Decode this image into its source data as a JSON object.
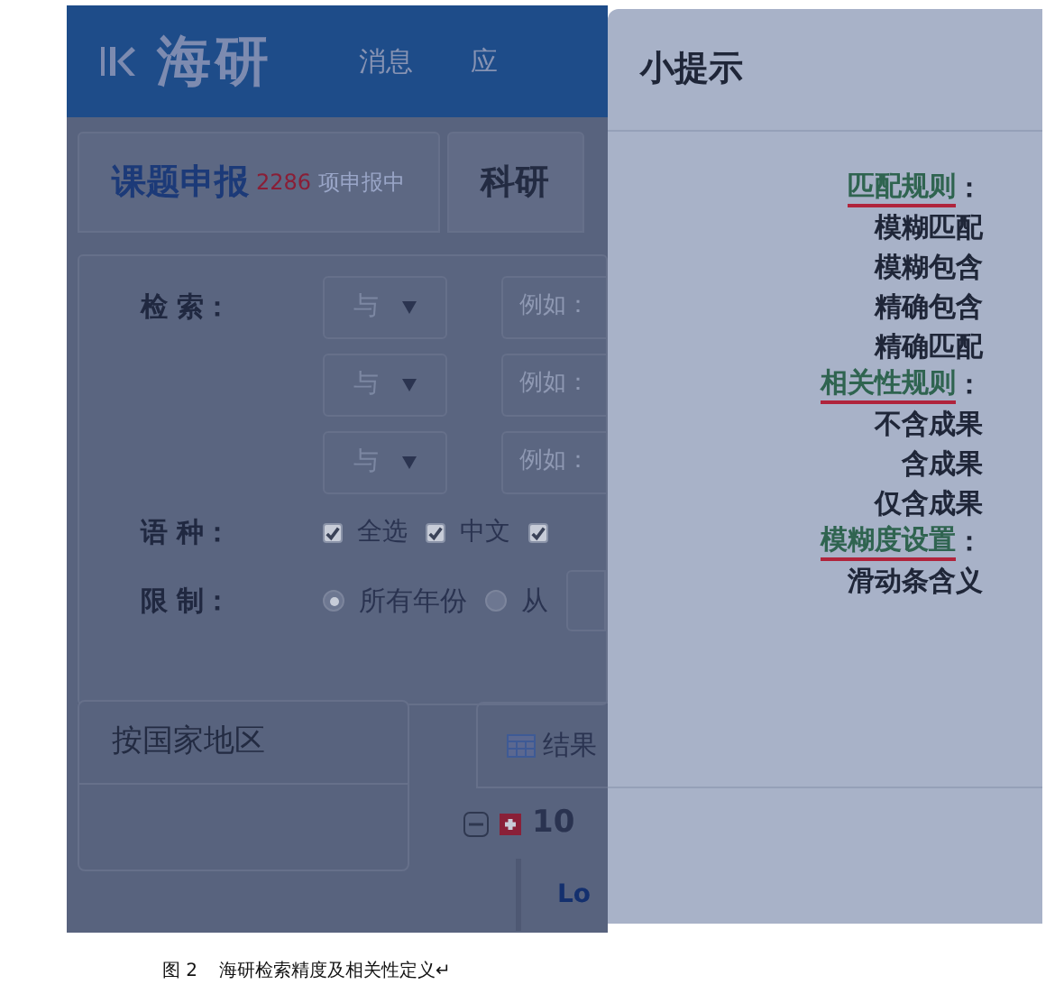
{
  "header": {
    "logo": "海研",
    "nav": [
      "消息",
      "应"
    ]
  },
  "tabs": [
    {
      "label": "课题申报",
      "count": "2286",
      "suffix": "项申报中",
      "selected": true
    },
    {
      "label": "科研",
      "selected": false
    }
  ],
  "search": {
    "label": "检 索：",
    "rows": [
      {
        "operator": "与",
        "placeholder": "例如："
      },
      {
        "operator": "与",
        "placeholder": "例如："
      },
      {
        "operator": "与",
        "placeholder": "例如："
      }
    ]
  },
  "language": {
    "label": "语 种：",
    "options": [
      {
        "label": "全选",
        "checked": true
      },
      {
        "label": "中文",
        "checked": true
      },
      {
        "checked": true
      }
    ]
  },
  "limit": {
    "label": "限 制：",
    "options": [
      {
        "label": "所有年份",
        "selected": true
      },
      {
        "label": "从",
        "selected": false
      }
    ]
  },
  "filter_panel": {
    "title": "按国家地区"
  },
  "results": {
    "title": "结果",
    "count": "10",
    "first_item": "Lo"
  },
  "dialog": {
    "title": "小提示",
    "sections": [
      {
        "heading": "匹配规则",
        "colon": "：",
        "items": [
          "模糊匹配",
          "模糊包含",
          "精确包含",
          "精确匹配"
        ]
      },
      {
        "heading": "相关性规则",
        "colon": "：",
        "items": [
          "不含成果",
          "含成果",
          "仅含成果"
        ]
      },
      {
        "heading": "模糊度设置",
        "colon": "：",
        "items": [
          "滑动条含义"
        ]
      }
    ]
  },
  "caption": {
    "figure_label": "图 2",
    "text": "海研检索精度及相关性定义↵"
  }
}
